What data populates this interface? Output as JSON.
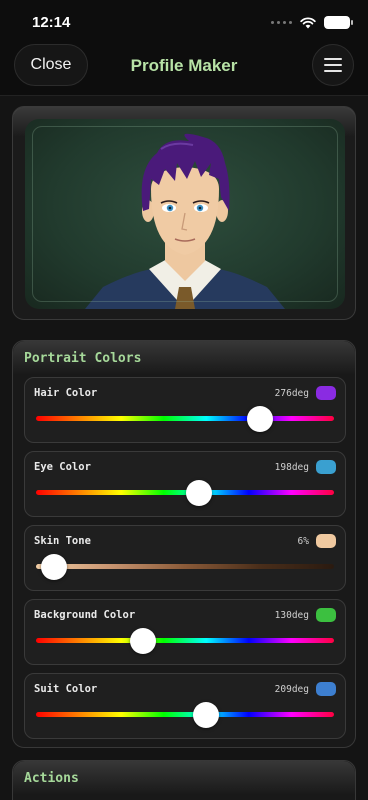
{
  "status_bar": {
    "time": "12:14"
  },
  "nav": {
    "close_label": "Close",
    "title": "Profile Maker"
  },
  "portrait_colors": {
    "title": "Portrait Colors",
    "sliders": [
      {
        "label": "Hair Color",
        "value": "276deg",
        "fraction": 0.753,
        "swatch": "#8a2be2",
        "track": "hue"
      },
      {
        "label": "Eye Color",
        "value": "198deg",
        "fraction": 0.547,
        "swatch": "#3aa0d0",
        "track": "hue"
      },
      {
        "label": "Skin Tone",
        "value": "6%",
        "fraction": 0.06,
        "swatch": "#f0c9a0",
        "track": "skin"
      },
      {
        "label": "Background Color",
        "value": "130deg",
        "fraction": 0.36,
        "swatch": "#3cc040",
        "track": "hue"
      },
      {
        "label": "Suit Color",
        "value": "209deg",
        "fraction": 0.572,
        "swatch": "#3d7fd0",
        "track": "hue"
      }
    ]
  },
  "actions": {
    "title": "Actions"
  },
  "colors": {
    "accent": "#b7e2a6",
    "background": "#141414"
  },
  "icons": [
    "wifi-icon",
    "battery-icon",
    "menu-icon",
    "signal-icon"
  ]
}
